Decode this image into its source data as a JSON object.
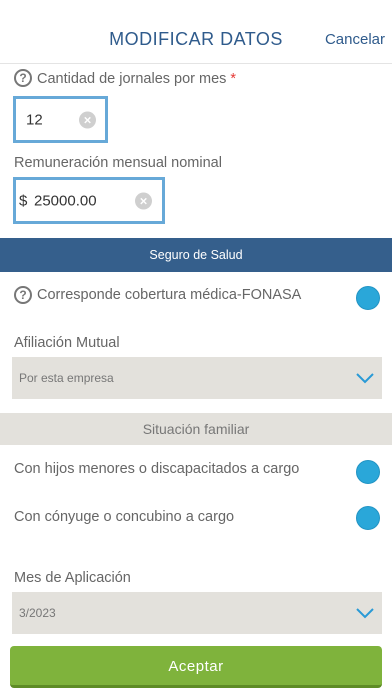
{
  "header": {
    "title": "MODIFICAR DATOS",
    "cancel_label": "Cancelar"
  },
  "form": {
    "jornales": {
      "label": "Cantidad de jornales por mes",
      "required_mark": "*",
      "value": "12"
    },
    "remuneracion": {
      "label": "Remuneración mensual nominal",
      "currency": "$",
      "value": "25000.00"
    }
  },
  "seguro_section": {
    "title": "Seguro de Salud"
  },
  "fonasa": {
    "label": "Corresponde cobertura médica-FONASA"
  },
  "mutual": {
    "label": "Afiliación Mutual",
    "selected": "Por esta empresa"
  },
  "familia_section": {
    "title": "Situación familiar"
  },
  "hijos": {
    "label": "Con hijos menores o discapacitados a cargo"
  },
  "conyuge": {
    "label": "Con cónyuge o concubino a cargo"
  },
  "mes": {
    "label": "Mes de Aplicación",
    "selected": "3/2023"
  },
  "accept_label": "Aceptar",
  "colors": {
    "accent_blue": "#355f8c",
    "input_border": "#67a9d8",
    "toggle": "#2aa7d9",
    "accept_green": "#7fb33c"
  },
  "icons": {
    "help": "question-circle-icon",
    "clear": "clear-x-icon",
    "chevron": "chevron-down-icon"
  }
}
